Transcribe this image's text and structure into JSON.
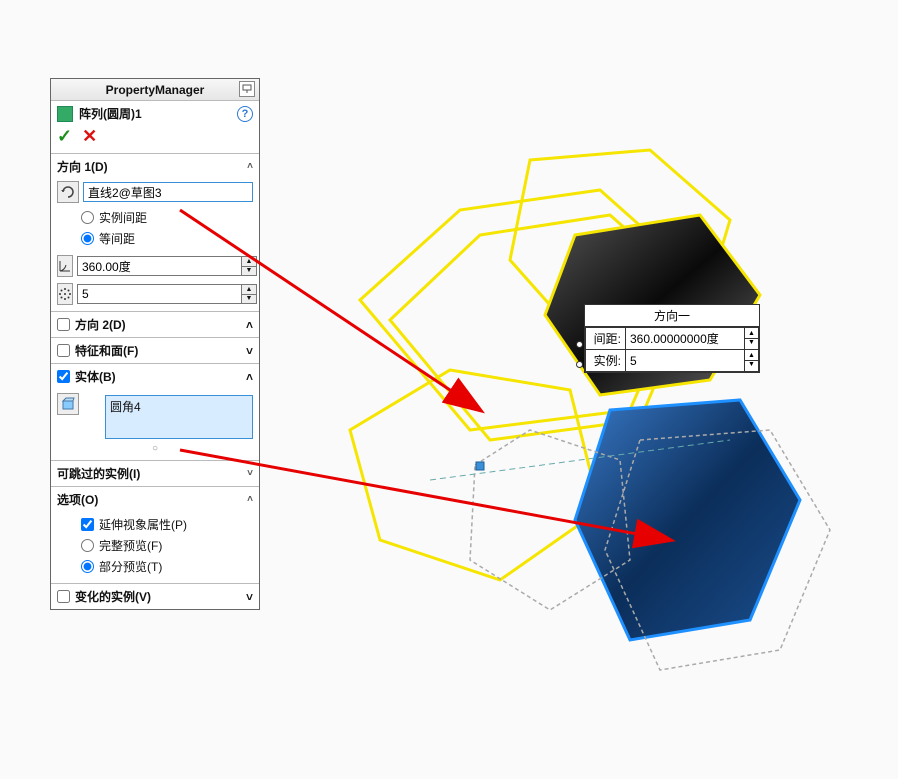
{
  "pm": {
    "title": "PropertyManager",
    "feature_name": "阵列(圆周)1",
    "help": "?",
    "direction1": {
      "label": "方向 1(D)",
      "axis": "直线2@草图3",
      "spacing_label": "实例间距",
      "equal_label": "等间距",
      "angle": "360.00度",
      "count": "5"
    },
    "direction2": {
      "label": "方向 2(D)"
    },
    "features_faces": {
      "label": "特征和面(F)"
    },
    "bodies": {
      "label": "实体(B)",
      "item": "圆角4"
    },
    "skippable": {
      "label": "可跳过的实例(I)"
    },
    "options": {
      "label": "选项(O)",
      "propagate": "延伸视象属性(P)",
      "full_preview": "完整预览(F)",
      "partial_preview": "部分预览(T)"
    },
    "varied": {
      "label": "变化的实例(V)"
    }
  },
  "callout": {
    "title": "方向一",
    "spacing_label": "间距:",
    "spacing_value": "360.00000000度",
    "instances_label": "实例:",
    "instances_value": "5"
  }
}
